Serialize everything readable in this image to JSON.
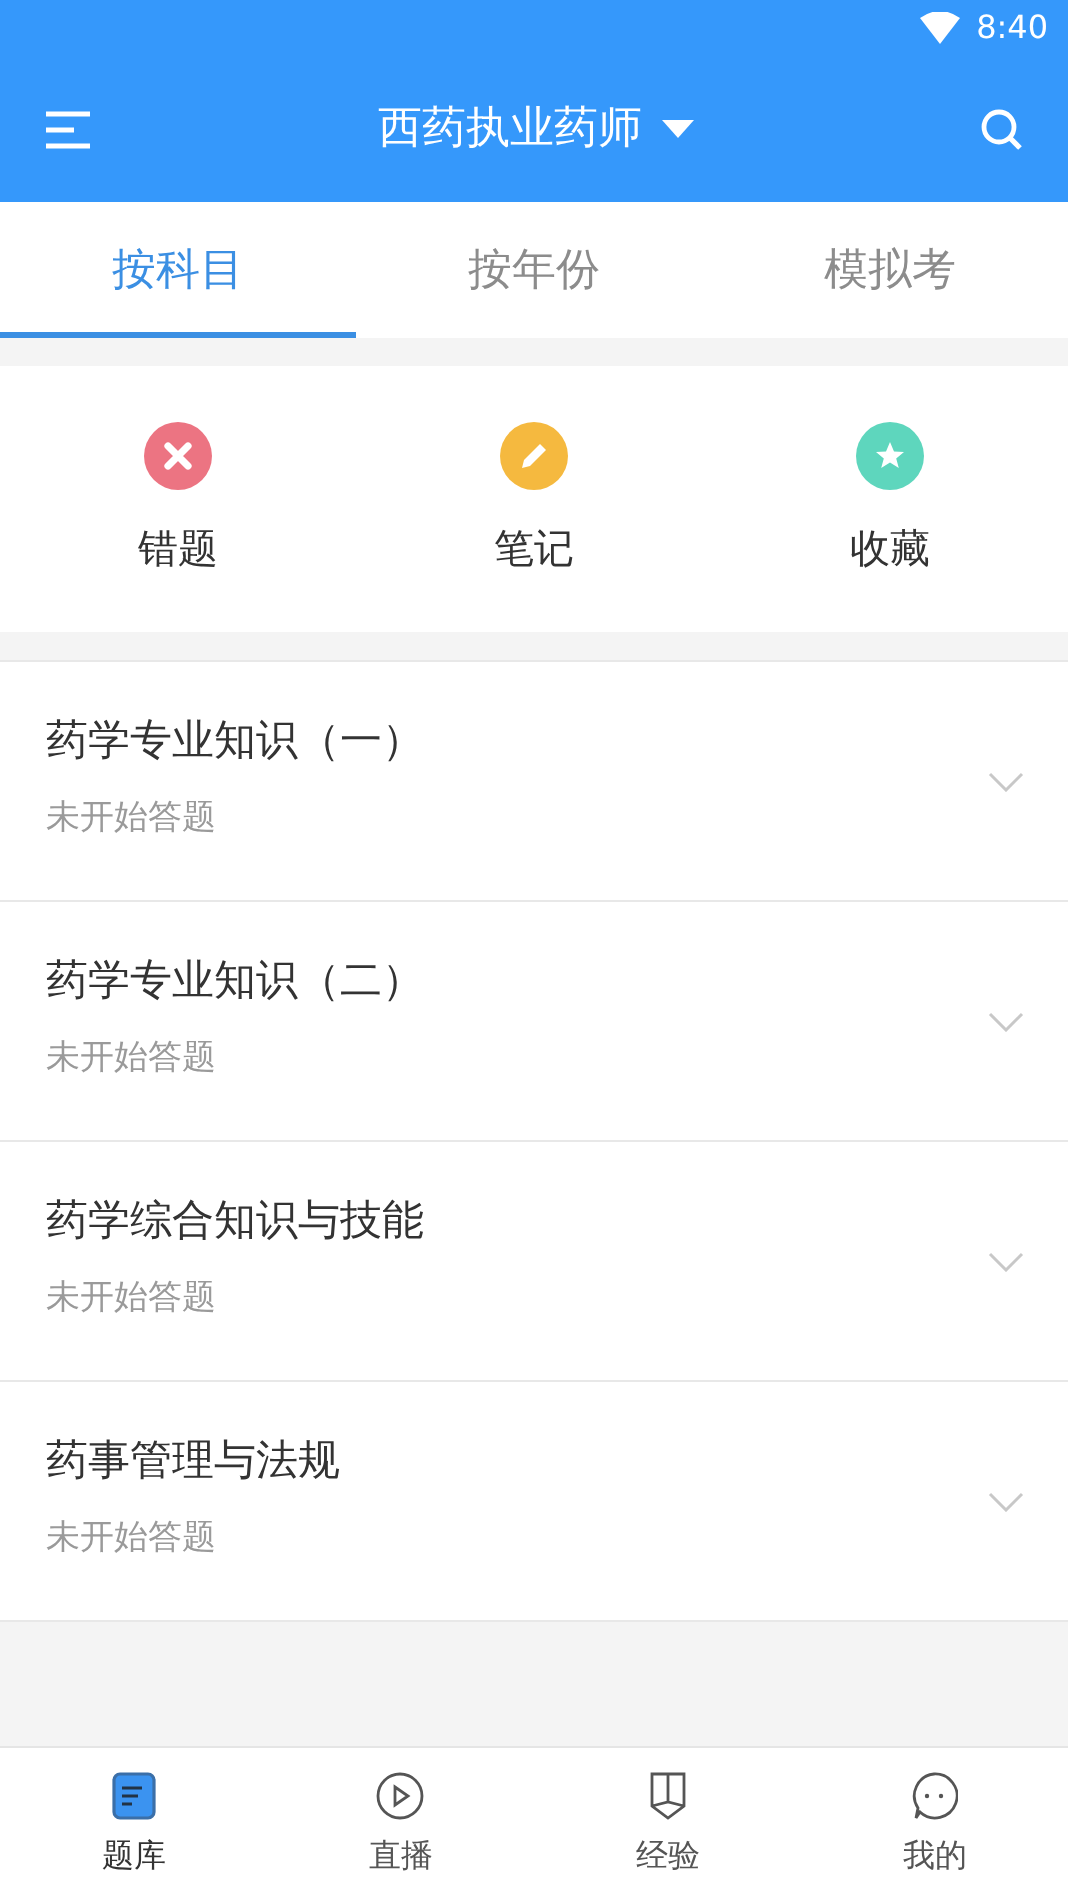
{
  "status_bar": {
    "time": "8:40"
  },
  "header": {
    "title": "西药执业药师"
  },
  "tabs": [
    {
      "label": "按科目",
      "selected": true
    },
    {
      "label": "按年份",
      "selected": false
    },
    {
      "label": "模拟考",
      "selected": false
    }
  ],
  "shortcuts": [
    {
      "kind": "wrong",
      "label": "错题",
      "color": "#ec7482"
    },
    {
      "kind": "note",
      "label": "笔记",
      "color": "#f5b93f"
    },
    {
      "kind": "favorite",
      "label": "收藏",
      "color": "#5ed6bd"
    }
  ],
  "subjects": [
    {
      "title": "药学专业知识（一）",
      "status": "未开始答题"
    },
    {
      "title": "药学专业知识（二）",
      "status": "未开始答题"
    },
    {
      "title": "药学综合知识与技能",
      "status": "未开始答题"
    },
    {
      "title": "药事管理与法规",
      "status": "未开始答题"
    }
  ],
  "bottom_nav": [
    {
      "kind": "bank",
      "label": "题库",
      "selected": true
    },
    {
      "kind": "live",
      "label": "直播",
      "selected": false
    },
    {
      "kind": "experience",
      "label": "经验",
      "selected": false
    },
    {
      "kind": "me",
      "label": "我的",
      "selected": false
    }
  ]
}
